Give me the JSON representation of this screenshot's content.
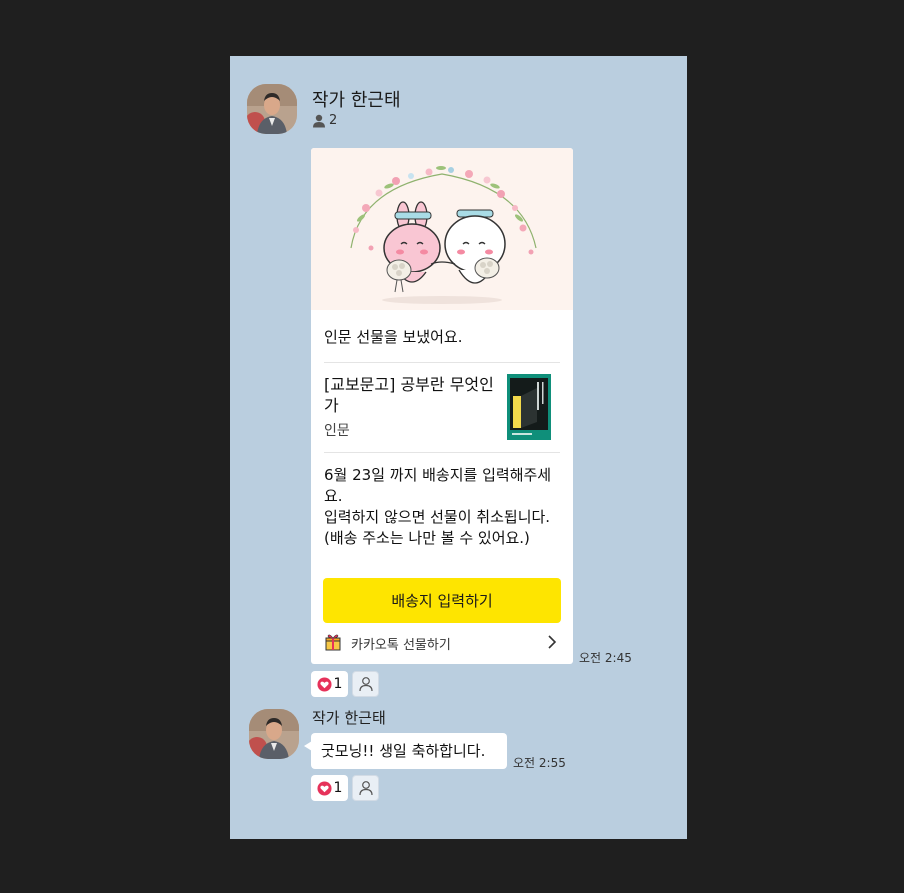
{
  "room": {
    "title": "작가 한근태",
    "member_count": "2",
    "member_icon": "person-icon"
  },
  "messages": [
    {
      "type": "gift_card",
      "sent_text": "인문 선물을 보냈어요.",
      "product_name": "[교보문고] 공부란 무엇인가",
      "product_category": "인문",
      "deadline_text": "6월 23일 까지 배송지를 입력해주세요.\n입력하지 않으면 선물이 취소됩니다.\n(배송 주소는 나만 볼 수 있어요.)",
      "button_label": "배송지 입력하기",
      "footer_label": "카카오톡 선물하기",
      "time": "오전 2:45",
      "reaction_count": "1"
    },
    {
      "type": "text",
      "sender": "작가 한근태",
      "text": "굿모닝!! 생일 축하합니다.",
      "time": "오전 2:55",
      "reaction_count": "1"
    }
  ],
  "colors": {
    "chat_background": "#bacedf",
    "window_background": "#1f1f1f",
    "button_yellow": "#fee500",
    "heart_red": "#e6325a"
  }
}
